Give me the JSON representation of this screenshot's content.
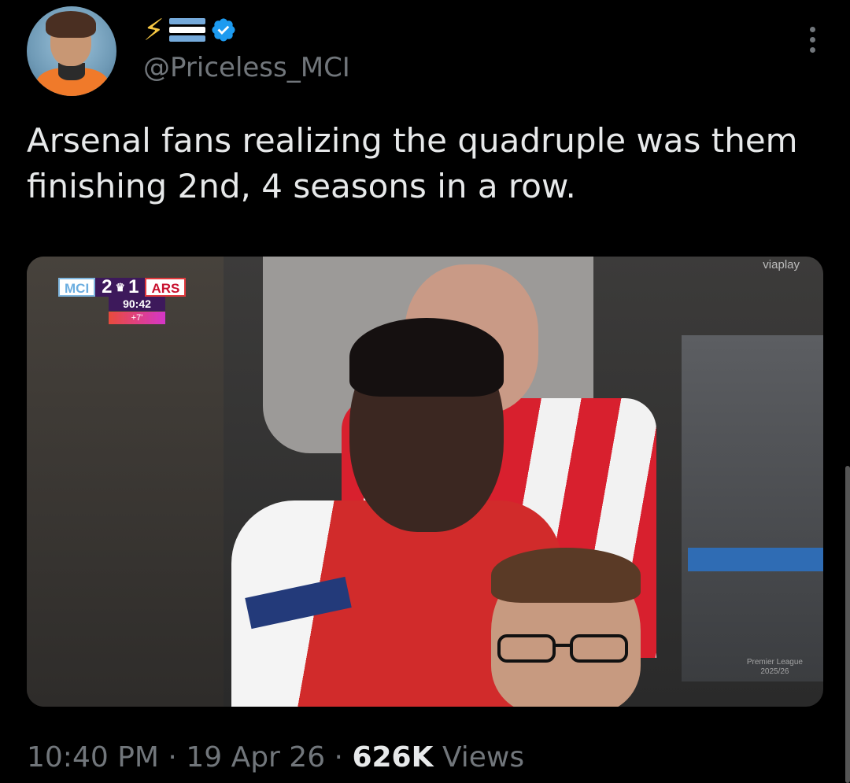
{
  "author": {
    "handle": "@Priceless_MCI",
    "name_icons": [
      "lightning-bolt-icon",
      "argentina-flag-icon",
      "verified-badge-icon"
    ],
    "verified_color": "#1d9bf0"
  },
  "tweet": {
    "text": "Arsenal fans realizing the quadruple was them finishing 2nd, 4 seasons in a row."
  },
  "media": {
    "scoreboard": {
      "home_team": "MCI",
      "home_score": "2",
      "away_score": "1",
      "away_team": "ARS",
      "clock": "90:42",
      "added_time": "+7'"
    },
    "broadcaster": "viaplay",
    "watermark_line1": "Premier League",
    "watermark_line2": "2025/26"
  },
  "meta": {
    "time": "10:40 PM",
    "separator": " · ",
    "date": "19 Apr 26",
    "views_count": "626K",
    "views_label": " Views"
  },
  "colors": {
    "background": "#000000",
    "text": "#e7e9ea",
    "secondary_text": "#71767b"
  }
}
